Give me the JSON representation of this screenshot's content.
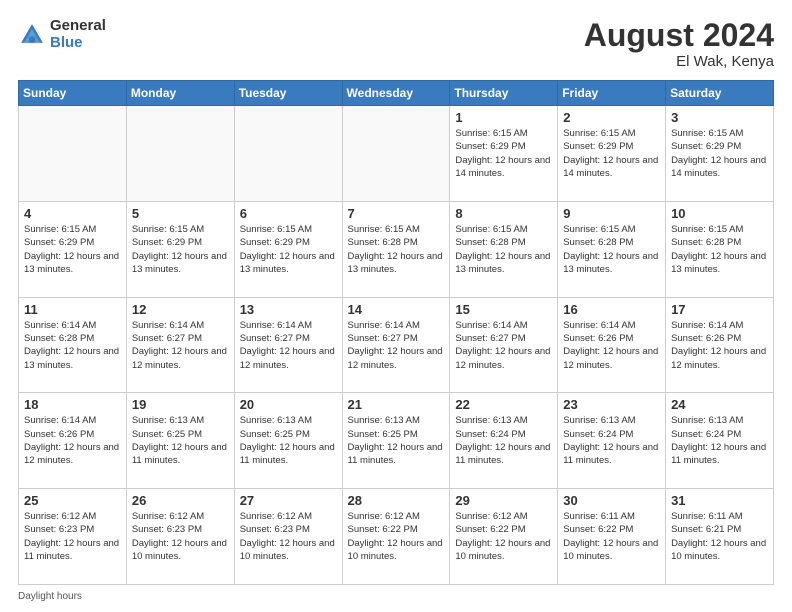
{
  "logo": {
    "general": "General",
    "blue": "Blue"
  },
  "title": "August 2024",
  "subtitle": "El Wak, Kenya",
  "footer": "Daylight hours",
  "headers": [
    "Sunday",
    "Monday",
    "Tuesday",
    "Wednesday",
    "Thursday",
    "Friday",
    "Saturday"
  ],
  "weeks": [
    [
      {
        "day": "",
        "info": ""
      },
      {
        "day": "",
        "info": ""
      },
      {
        "day": "",
        "info": ""
      },
      {
        "day": "",
        "info": ""
      },
      {
        "day": "1",
        "info": "Sunrise: 6:15 AM\nSunset: 6:29 PM\nDaylight: 12 hours\nand 14 minutes."
      },
      {
        "day": "2",
        "info": "Sunrise: 6:15 AM\nSunset: 6:29 PM\nDaylight: 12 hours\nand 14 minutes."
      },
      {
        "day": "3",
        "info": "Sunrise: 6:15 AM\nSunset: 6:29 PM\nDaylight: 12 hours\nand 14 minutes."
      }
    ],
    [
      {
        "day": "4",
        "info": "Sunrise: 6:15 AM\nSunset: 6:29 PM\nDaylight: 12 hours\nand 13 minutes."
      },
      {
        "day": "5",
        "info": "Sunrise: 6:15 AM\nSunset: 6:29 PM\nDaylight: 12 hours\nand 13 minutes."
      },
      {
        "day": "6",
        "info": "Sunrise: 6:15 AM\nSunset: 6:29 PM\nDaylight: 12 hours\nand 13 minutes."
      },
      {
        "day": "7",
        "info": "Sunrise: 6:15 AM\nSunset: 6:28 PM\nDaylight: 12 hours\nand 13 minutes."
      },
      {
        "day": "8",
        "info": "Sunrise: 6:15 AM\nSunset: 6:28 PM\nDaylight: 12 hours\nand 13 minutes."
      },
      {
        "day": "9",
        "info": "Sunrise: 6:15 AM\nSunset: 6:28 PM\nDaylight: 12 hours\nand 13 minutes."
      },
      {
        "day": "10",
        "info": "Sunrise: 6:15 AM\nSunset: 6:28 PM\nDaylight: 12 hours\nand 13 minutes."
      }
    ],
    [
      {
        "day": "11",
        "info": "Sunrise: 6:14 AM\nSunset: 6:28 PM\nDaylight: 12 hours\nand 13 minutes."
      },
      {
        "day": "12",
        "info": "Sunrise: 6:14 AM\nSunset: 6:27 PM\nDaylight: 12 hours\nand 12 minutes."
      },
      {
        "day": "13",
        "info": "Sunrise: 6:14 AM\nSunset: 6:27 PM\nDaylight: 12 hours\nand 12 minutes."
      },
      {
        "day": "14",
        "info": "Sunrise: 6:14 AM\nSunset: 6:27 PM\nDaylight: 12 hours\nand 12 minutes."
      },
      {
        "day": "15",
        "info": "Sunrise: 6:14 AM\nSunset: 6:27 PM\nDaylight: 12 hours\nand 12 minutes."
      },
      {
        "day": "16",
        "info": "Sunrise: 6:14 AM\nSunset: 6:26 PM\nDaylight: 12 hours\nand 12 minutes."
      },
      {
        "day": "17",
        "info": "Sunrise: 6:14 AM\nSunset: 6:26 PM\nDaylight: 12 hours\nand 12 minutes."
      }
    ],
    [
      {
        "day": "18",
        "info": "Sunrise: 6:14 AM\nSunset: 6:26 PM\nDaylight: 12 hours\nand 12 minutes."
      },
      {
        "day": "19",
        "info": "Sunrise: 6:13 AM\nSunset: 6:25 PM\nDaylight: 12 hours\nand 11 minutes."
      },
      {
        "day": "20",
        "info": "Sunrise: 6:13 AM\nSunset: 6:25 PM\nDaylight: 12 hours\nand 11 minutes."
      },
      {
        "day": "21",
        "info": "Sunrise: 6:13 AM\nSunset: 6:25 PM\nDaylight: 12 hours\nand 11 minutes."
      },
      {
        "day": "22",
        "info": "Sunrise: 6:13 AM\nSunset: 6:24 PM\nDaylight: 12 hours\nand 11 minutes."
      },
      {
        "day": "23",
        "info": "Sunrise: 6:13 AM\nSunset: 6:24 PM\nDaylight: 12 hours\nand 11 minutes."
      },
      {
        "day": "24",
        "info": "Sunrise: 6:13 AM\nSunset: 6:24 PM\nDaylight: 12 hours\nand 11 minutes."
      }
    ],
    [
      {
        "day": "25",
        "info": "Sunrise: 6:12 AM\nSunset: 6:23 PM\nDaylight: 12 hours\nand 11 minutes."
      },
      {
        "day": "26",
        "info": "Sunrise: 6:12 AM\nSunset: 6:23 PM\nDaylight: 12 hours\nand 10 minutes."
      },
      {
        "day": "27",
        "info": "Sunrise: 6:12 AM\nSunset: 6:23 PM\nDaylight: 12 hours\nand 10 minutes."
      },
      {
        "day": "28",
        "info": "Sunrise: 6:12 AM\nSunset: 6:22 PM\nDaylight: 12 hours\nand 10 minutes."
      },
      {
        "day": "29",
        "info": "Sunrise: 6:12 AM\nSunset: 6:22 PM\nDaylight: 12 hours\nand 10 minutes."
      },
      {
        "day": "30",
        "info": "Sunrise: 6:11 AM\nSunset: 6:22 PM\nDaylight: 12 hours\nand 10 minutes."
      },
      {
        "day": "31",
        "info": "Sunrise: 6:11 AM\nSunset: 6:21 PM\nDaylight: 12 hours\nand 10 minutes."
      }
    ]
  ]
}
